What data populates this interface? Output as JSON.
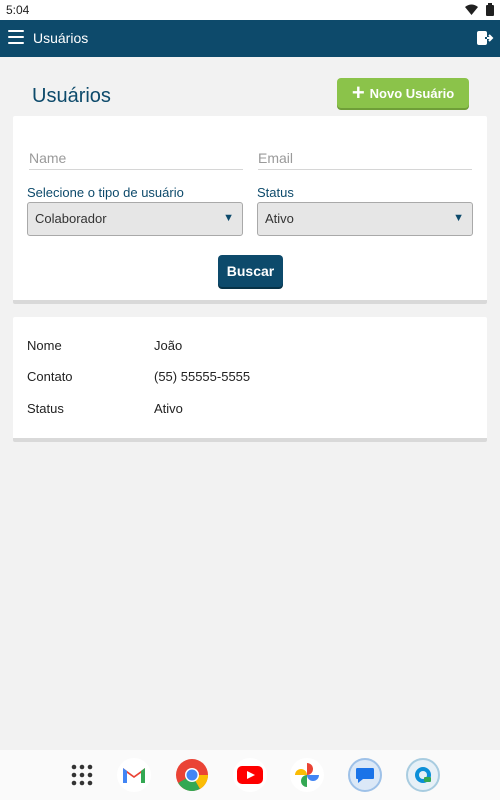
{
  "status_bar": {
    "time": "5:04"
  },
  "app_bar": {
    "title": "Usuários"
  },
  "page": {
    "title": "Usuários",
    "new_user_label": "Novo Usuário"
  },
  "filters": {
    "name_placeholder": "Name",
    "email_placeholder": "Email",
    "type_label": "Selecione o tipo de usuário",
    "type_value": "Colaborador",
    "status_label": "Status",
    "status_value": "Ativo",
    "search_label": "Buscar"
  },
  "result": {
    "rows": [
      {
        "key": "Nome",
        "value": "João"
      },
      {
        "key": "Contato",
        "value": "(55) 55555-5555"
      },
      {
        "key": "Status",
        "value": "Ativo"
      }
    ]
  },
  "colors": {
    "primary": "#0d4a6b",
    "accent": "#8bc34a",
    "background": "#f2f2f2"
  },
  "dock": {
    "apps": [
      "app-drawer-icon",
      "gmail-icon",
      "chrome-icon",
      "youtube-icon",
      "photos-icon",
      "messages-icon",
      "assistant-icon"
    ]
  }
}
